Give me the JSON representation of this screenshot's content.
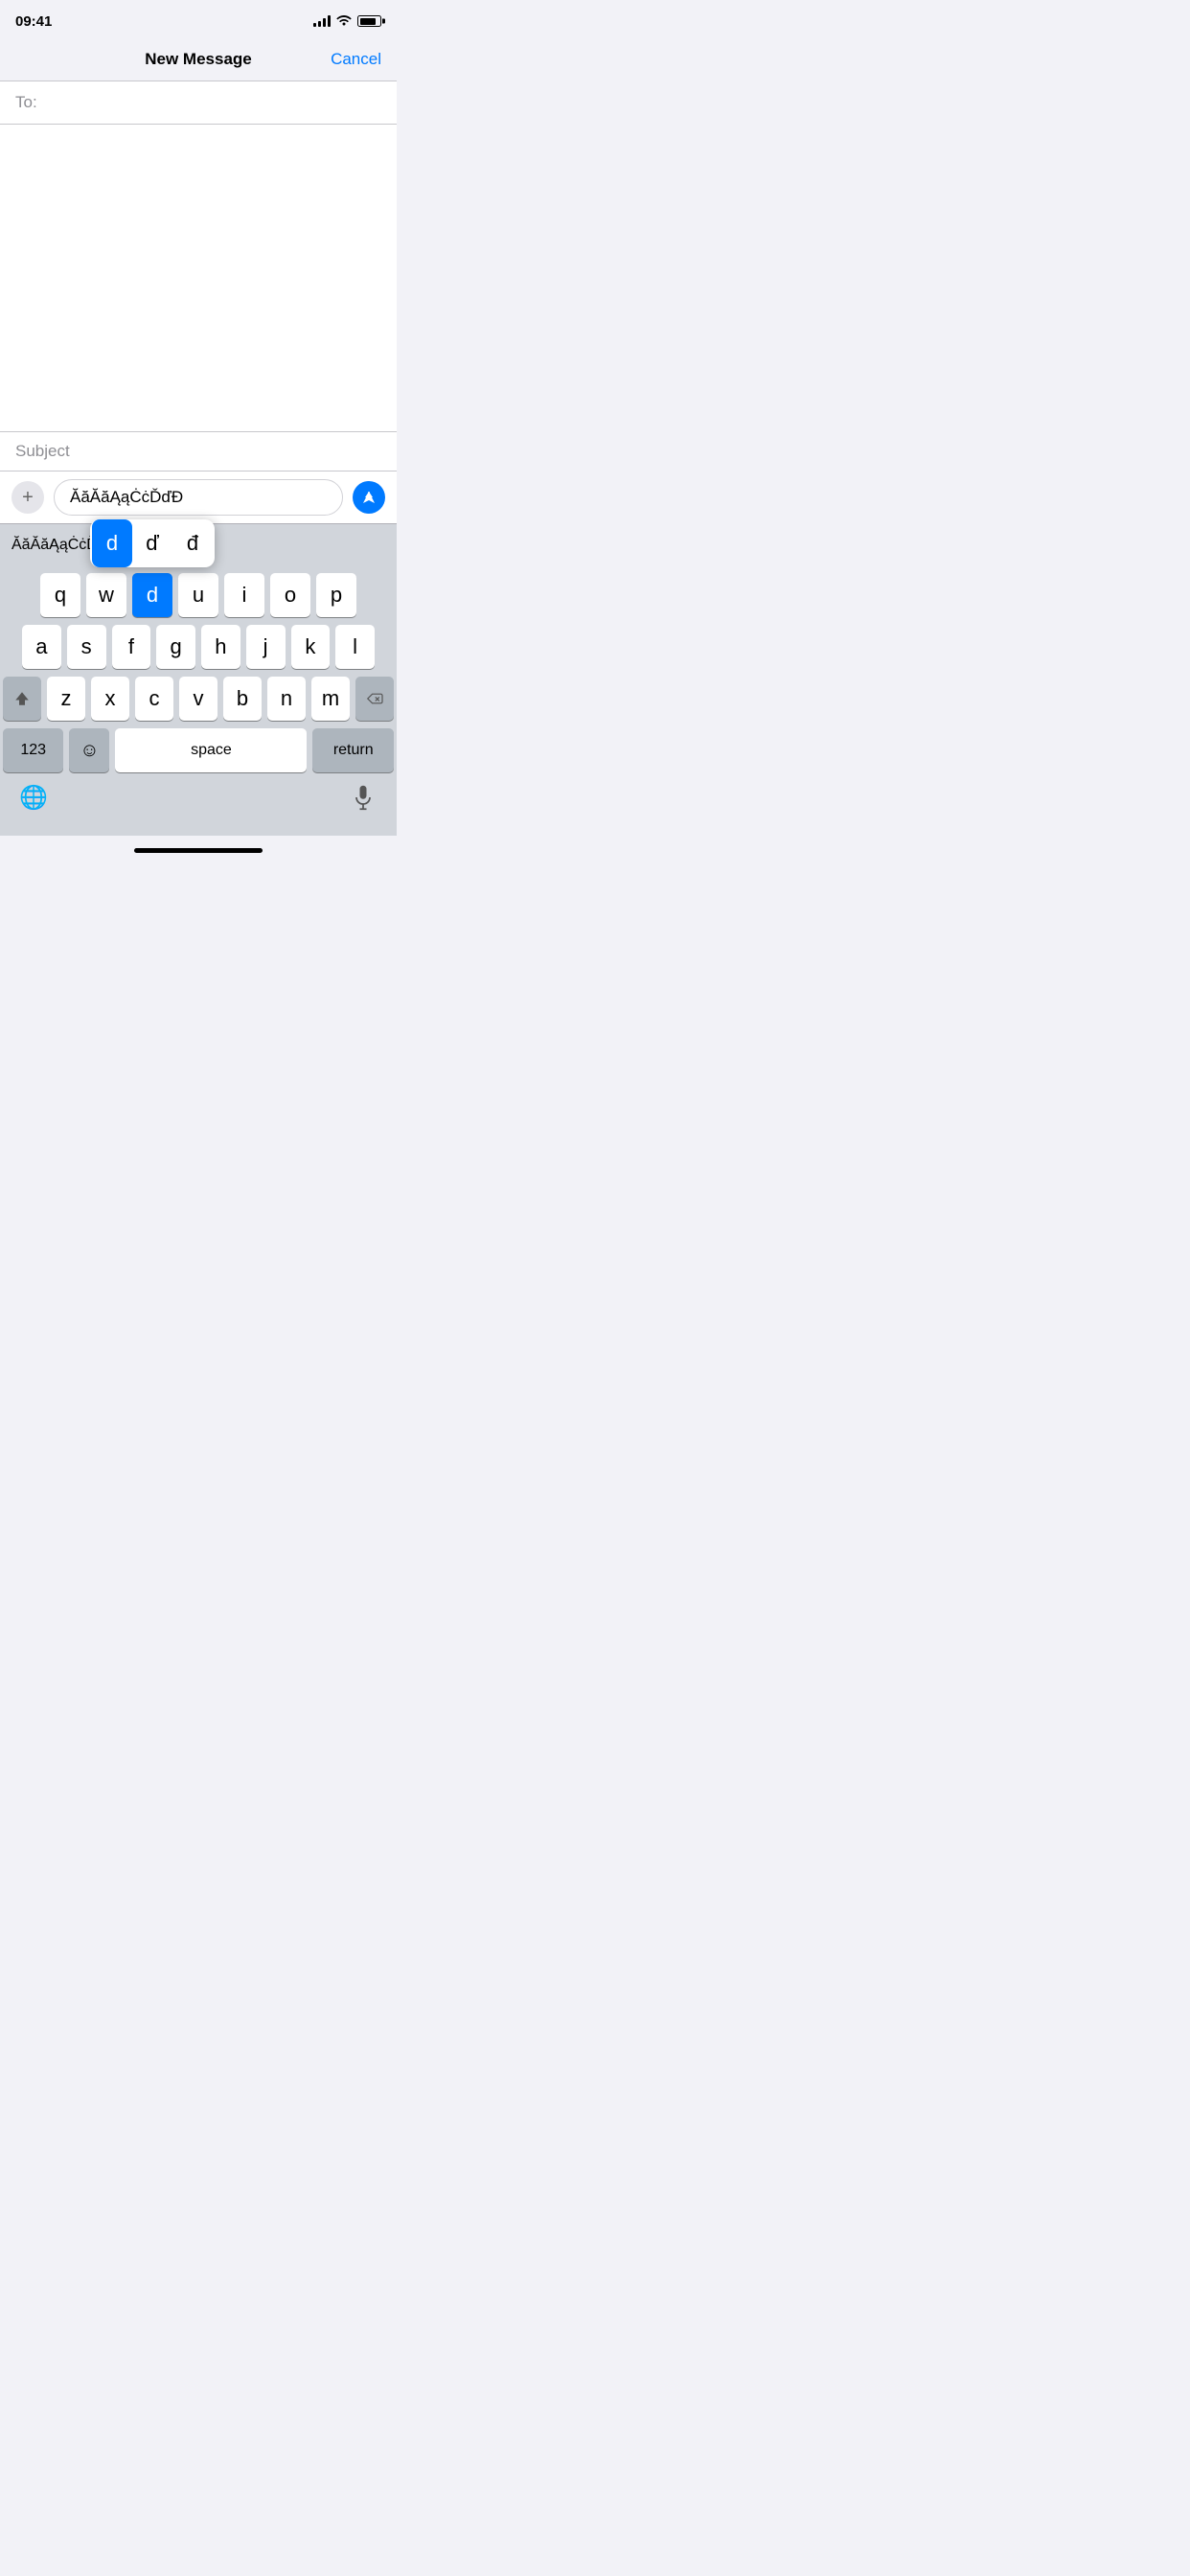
{
  "status_bar": {
    "time": "09:41",
    "signal_label": "signal",
    "wifi_label": "wifi",
    "battery_label": "battery"
  },
  "nav": {
    "title": "New Message",
    "cancel_label": "Cancel"
  },
  "compose": {
    "to_label": "To:",
    "to_value": "",
    "to_placeholder": "",
    "subject_placeholder": "Subject",
    "subject_value": "",
    "message_value": "ĂăĂăĄąĊċĎďĐ"
  },
  "autocomplete": {
    "text": "ĂăĂăĄąĊċĎďĐ\""
  },
  "keyboard": {
    "row1": [
      "q",
      "w",
      "d",
      "u",
      "i",
      "o",
      "p"
    ],
    "row1_popup": [
      "d",
      "ď",
      "đ"
    ],
    "row2": [
      "a",
      "s",
      "f",
      "g",
      "h",
      "j",
      "k",
      "l"
    ],
    "row3": [
      "z",
      "x",
      "c",
      "v",
      "b",
      "n",
      "m"
    ],
    "shift_label": "⇧",
    "delete_label": "⌫",
    "numbers_label": "123",
    "emoji_label": "☺",
    "space_label": "space",
    "return_label": "return",
    "globe_label": "🌐",
    "mic_label": "mic"
  },
  "buttons": {
    "add_label": "+",
    "send_label": "↑"
  }
}
